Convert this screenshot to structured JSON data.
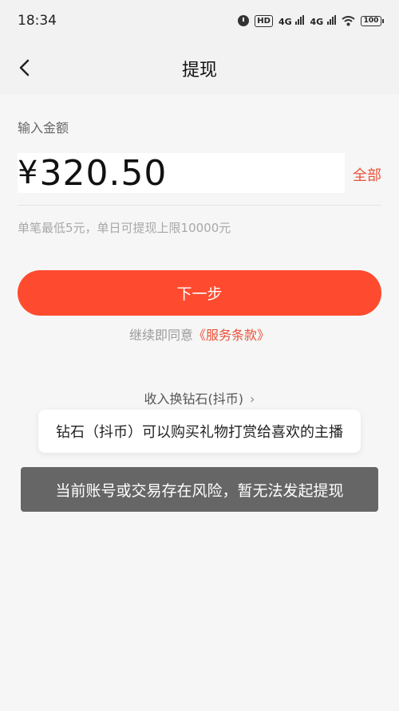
{
  "status_bar": {
    "time": "18:34",
    "hd_label": "HD",
    "network_1": "4G",
    "network_2": "4G",
    "battery": "100"
  },
  "header": {
    "title": "提现",
    "back_icon": "chevron-left-icon"
  },
  "withdraw": {
    "amount_label": "输入金额",
    "currency_symbol": "¥",
    "amount_value": "320.50",
    "all_label": "全部",
    "limit_hint": "单笔最低5元，单日可提现上限10000元"
  },
  "actions": {
    "next_label": "下一步",
    "agree_prefix": "继续即同意",
    "terms_link": "《服务条款》"
  },
  "exchange": {
    "label": "收入换钻石(抖币)",
    "chevron": "›"
  },
  "tip": {
    "text": "钻石（抖币）可以购买礼物打赏给喜欢的主播"
  },
  "toast": {
    "text": "当前账号或交易存在风险，暂无法发起提现"
  },
  "colors": {
    "accent": "#fe4b2f",
    "link": "#e8533b",
    "background": "#f6f6f6",
    "toast_bg": "#666666"
  }
}
